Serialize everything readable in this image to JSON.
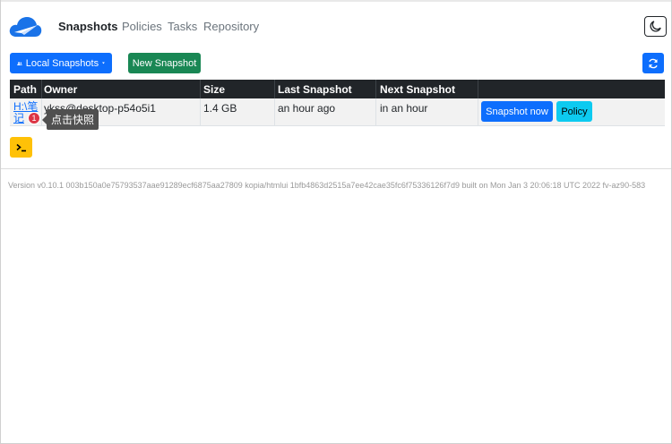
{
  "nav": {
    "links": [
      "Snapshots",
      "Policies",
      "Tasks",
      "Repository"
    ],
    "active": "Snapshots"
  },
  "toolbar": {
    "dropdown_label": "Local Snapshots",
    "new_snapshot_label": "New Snapshot"
  },
  "table": {
    "headers": [
      "Path",
      "Owner",
      "Size",
      "Last Snapshot",
      "Next Snapshot"
    ],
    "rows": [
      {
        "path_line1": "H:\\笔",
        "path_line2": "记",
        "owner": "ykss@desktop-p54o5i1",
        "size": "1.4 GB",
        "last_snapshot": "an hour ago",
        "next_snapshot": "in an hour",
        "snapshot_now_label": "Snapshot now",
        "policy_label": "Policy"
      }
    ]
  },
  "annotation": {
    "badge": "1",
    "tooltip": "点击快照"
  },
  "footer": {
    "version_text": "Version v0.10.1 003b150a0e75793537aae91289ecf6875aa27809 kopia/htmlui 1bfb4863d2515a7ee42cae35fc6f75336126f7d9 built on Mon Jan 3 20:06:18 UTC 2022 fv-az90-583"
  },
  "colors": {
    "primary": "#0d6efd",
    "success": "#198754",
    "info": "#0dcaf0",
    "warning": "#ffc107",
    "dark": "#212529",
    "danger": "#dc3545"
  },
  "icons": [
    "cloud-logo-icon",
    "moon-icon",
    "users-icon",
    "caret-down-icon",
    "refresh-icon",
    "terminal-icon"
  ]
}
